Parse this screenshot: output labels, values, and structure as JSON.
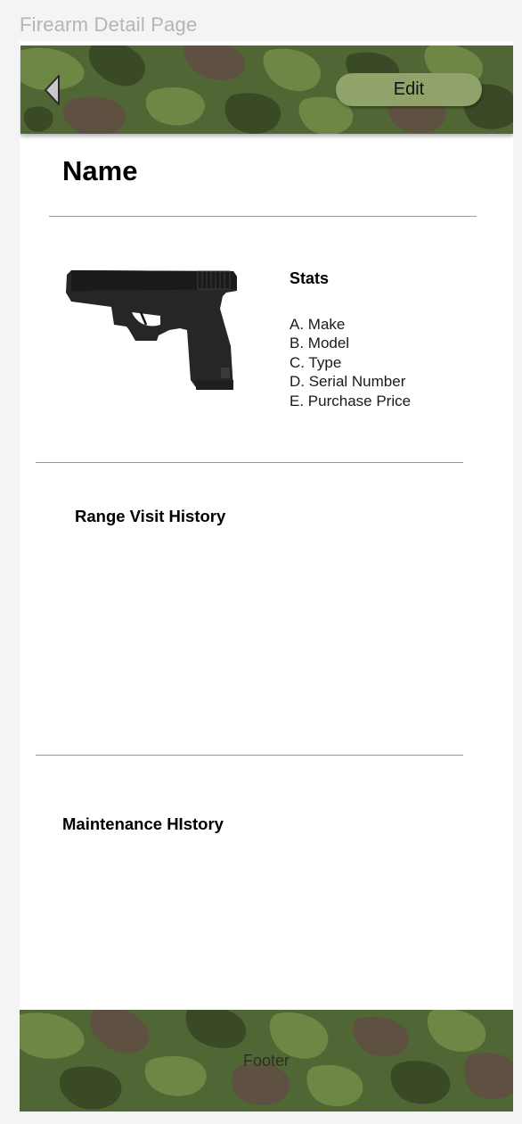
{
  "frame_label": "Firearm Detail Page",
  "header": {
    "back_icon": "chevron-left-icon",
    "edit_label": "Edit"
  },
  "page": {
    "title": "Name"
  },
  "stats": {
    "heading": "Stats",
    "items": [
      "A. Make",
      "B. Model",
      "C. Type",
      "D. Serial Number",
      "E. Purchase Price"
    ]
  },
  "range_visit_history": {
    "heading": "Range Visit History"
  },
  "maintenance_history": {
    "heading": "Maintenance HIstory"
  },
  "footer": {
    "label": "Footer"
  },
  "colors": {
    "camo_base": "#506634",
    "camo_light": "#6f8745",
    "camo_dark": "#3a4a26",
    "camo_brown": "#5e5141",
    "edit_button": "#8fa36a",
    "page_background": "#f4f4f4"
  }
}
